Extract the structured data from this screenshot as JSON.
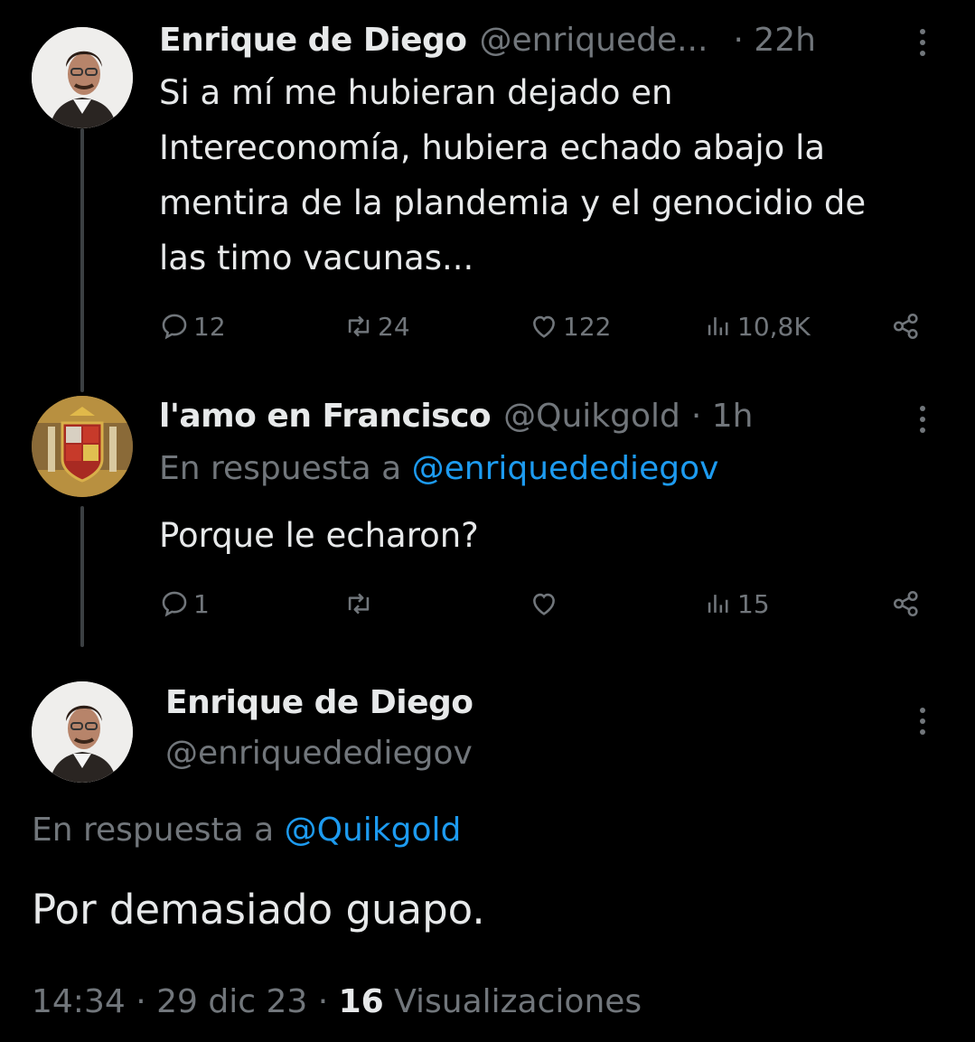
{
  "tweet1": {
    "name": "Enrique de Diego",
    "handle": "@enriquede...",
    "time": "· 22h",
    "lines": [
      "Si a mí me hubieran dejado en",
      "Intereconomía, hubiera echado abajo la",
      "mentira de la plandemia y el genocidio de",
      "las timo vacunas..."
    ],
    "replies": "12",
    "retweets": "24",
    "likes": "122",
    "views": "10,8K"
  },
  "tweet2": {
    "name": "l'amo en Francisco",
    "handle": "@Quikgold",
    "time": "· 1h",
    "reply_prefix": "En respuesta a",
    "reply_to": "@enriquedediegov",
    "text": "Porque le echaron?",
    "replies": "1",
    "retweets": "",
    "likes": "",
    "views": "15"
  },
  "tweet3": {
    "name": "Enrique de Diego",
    "handle": "@enriquedediegov",
    "reply_prefix": "En respuesta a",
    "reply_to": "@Quikgold",
    "text": "Por demasiado guapo.",
    "time": "14:34",
    "sep1": "·",
    "date": "29 dic 23",
    "sep2": "·",
    "views_count": "16",
    "views_label": "Visualizaciones"
  },
  "colors": {
    "background": "#000000",
    "text": "#e7e9ea",
    "muted": "#71767b",
    "link": "#1d9bf0"
  }
}
